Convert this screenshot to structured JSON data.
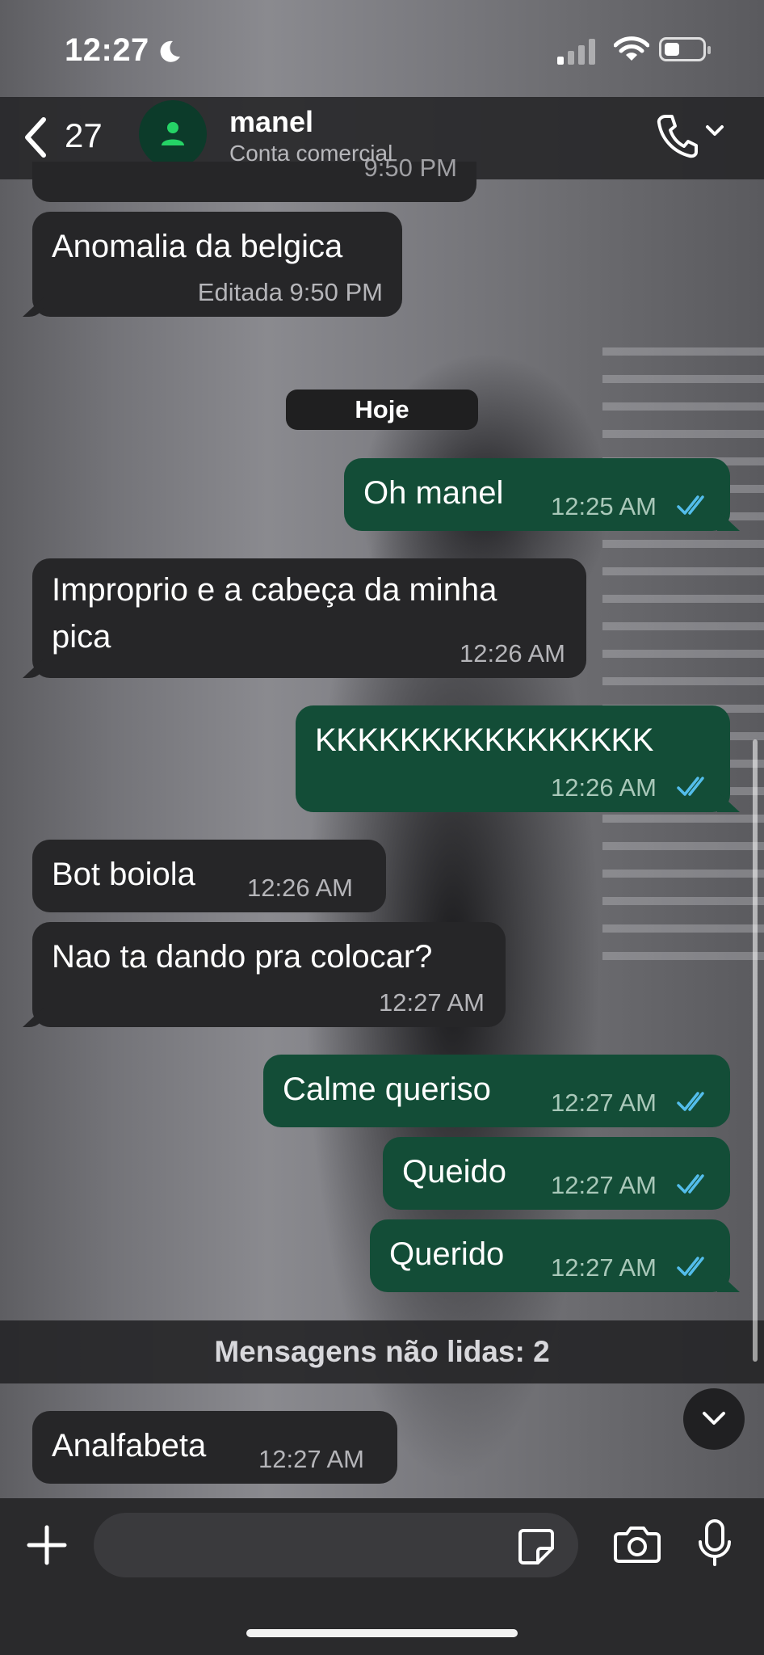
{
  "status_bar": {
    "time": "12:27"
  },
  "header": {
    "back_count": "27",
    "contact_name": "manel",
    "contact_subtitle": "Conta comercial"
  },
  "partial_top_time": "9:50 PM",
  "messages": [
    {
      "direction": "in",
      "text": "Anomalia da belgica",
      "meta": "Editada 9:50 PM"
    },
    {
      "direction": "out",
      "text": "Oh manel",
      "meta": "12:25 AM",
      "status": "read"
    },
    {
      "direction": "in",
      "text_line1": "Improprio e a cabeça da minha",
      "text_line2": "pica",
      "meta": "12:26 AM"
    },
    {
      "direction": "out",
      "text": "KKKKKKKKKKKKKKKK",
      "meta": "12:26 AM",
      "status": "read"
    },
    {
      "direction": "in",
      "text": "Bot boiola",
      "meta": "12:26 AM"
    },
    {
      "direction": "in",
      "text": "Nao ta dando pra colocar?",
      "meta": "12:27 AM"
    },
    {
      "direction": "out",
      "text": "Calme queriso",
      "meta": "12:27 AM",
      "status": "read"
    },
    {
      "direction": "out",
      "text": "Queido",
      "meta": "12:27 AM",
      "status": "read"
    },
    {
      "direction": "out",
      "text": "Querido",
      "meta": "12:27 AM",
      "status": "read"
    },
    {
      "direction": "in",
      "text": "Analfabeta",
      "meta": "12:27 AM"
    }
  ],
  "day_divider": "Hoje",
  "unread_banner": "Mensagens não lidas: 2",
  "composer": {
    "placeholder": ""
  },
  "colors": {
    "incoming_bubble": "#262628",
    "outgoing_bubble": "#134d37",
    "read_ticks": "#53bdeb"
  },
  "icons": [
    "back-chevron-icon",
    "person-icon",
    "phone-icon",
    "chevron-down-icon",
    "plus-icon",
    "sticker-icon",
    "camera-icon",
    "microphone-icon"
  ]
}
